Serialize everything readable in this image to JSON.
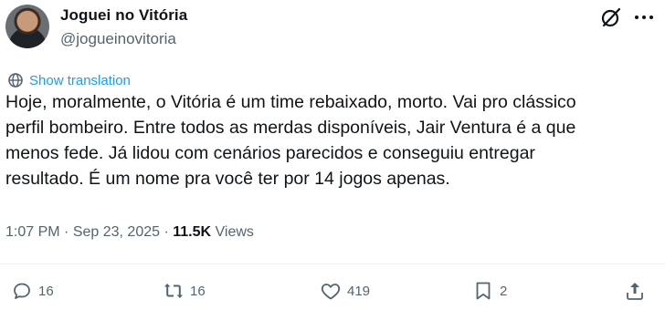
{
  "author": {
    "display_name": "Joguei no Vitória",
    "handle": "@jogueinovitoria",
    "avatar_icon": "profile-photo"
  },
  "header_icons": [
    "grok-icon",
    "more-icon"
  ],
  "translate": {
    "icon": "globe-icon",
    "label": "Show translation"
  },
  "tweet": {
    "lines": [
      "Hoje, moralmente, o Vitória é um time rebaixado, morto. Vai pro clássico",
      "perfil bombeiro. Entre todos as merdas disponíveis, Jair Ventura é a que",
      "menos fede. Já lidou com cenários parecidos e conseguiu entregar",
      "resultado. É um nome pra você ter por 14 jogos apenas."
    ]
  },
  "meta": {
    "time": "1:07 PM",
    "separator": "·",
    "date": "Sep 23, 2025",
    "views_count": "11.5K",
    "views_label": "Views"
  },
  "actions": {
    "replies": "16",
    "reposts": "16",
    "likes": "419",
    "bookmarks": "2"
  },
  "colors": {
    "text": "#0f1419",
    "secondary": "#536471",
    "link": "#1d9bf0",
    "divider": "#eff3f4"
  }
}
